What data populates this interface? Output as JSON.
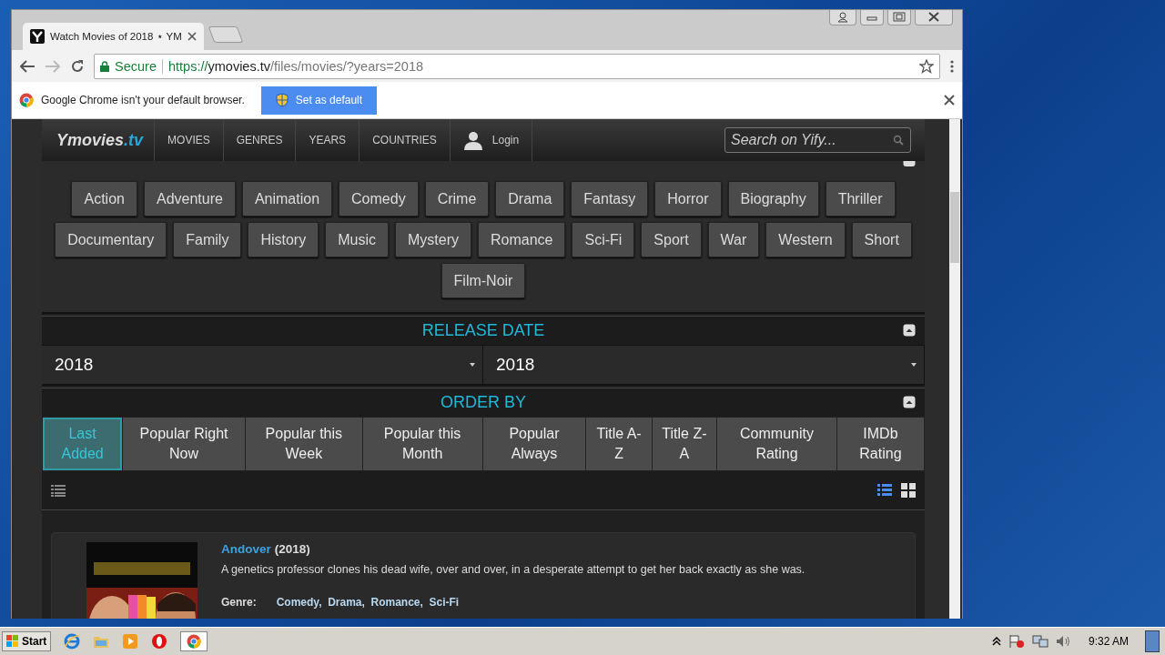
{
  "browser": {
    "tab_title": "Watch Movies of 2018 ⋆ YM",
    "secure_label": "Secure",
    "url_scheme": "https://",
    "url_host": "ymovies.tv",
    "url_path": "/files/movies/?years=2018",
    "infobar_text": "Google Chrome isn't your default browser.",
    "infobar_button": "Set as default"
  },
  "site": {
    "logo_main": "Ymovies",
    "logo_tld": ".tv",
    "nav": [
      "MOVIES",
      "GENRES",
      "YEARS",
      "COUNTRIES"
    ],
    "login": "Login",
    "search_placeholder": "Search on Yify..."
  },
  "genres": [
    "Action",
    "Adventure",
    "Animation",
    "Comedy",
    "Crime",
    "Drama",
    "Fantasy",
    "Horror",
    "Biography",
    "Thriller",
    "Documentary",
    "Family",
    "History",
    "Music",
    "Mystery",
    "Romance",
    "Sci-Fi",
    "Sport",
    "War",
    "Western",
    "Short",
    "Film-Noir"
  ],
  "release_date": {
    "title": "RELEASE DATE",
    "from": "2018",
    "to": "2018"
  },
  "order_by": {
    "title": "ORDER BY",
    "options": [
      {
        "label": "Last Added",
        "selected": true
      },
      {
        "label": "Popular Right Now",
        "selected": false
      },
      {
        "label": "Popular this Week",
        "selected": false
      },
      {
        "label": "Popular this Month",
        "selected": false
      },
      {
        "label": "Popular Always",
        "selected": false
      },
      {
        "label": "Title A-Z",
        "selected": false
      },
      {
        "label": "Title Z-A",
        "selected": false
      },
      {
        "label": "Community Rating",
        "selected": false
      },
      {
        "label": "IMDb Rating",
        "selected": false
      }
    ]
  },
  "view_modes": [
    {
      "kind": "list",
      "selected": true
    },
    {
      "kind": "grid",
      "selected": false
    }
  ],
  "movies": [
    {
      "title": "Andover",
      "year": "(2018)",
      "description": "A genetics professor clones his dead wife, over and over, in a desperate attempt to get her back exactly as she was.",
      "genre_label": "Genre:",
      "genres": "Comedy,  Drama,  Romance,  Sci-Fi"
    }
  ],
  "taskbar": {
    "start": "Start",
    "clock": "9:32 AM"
  }
}
